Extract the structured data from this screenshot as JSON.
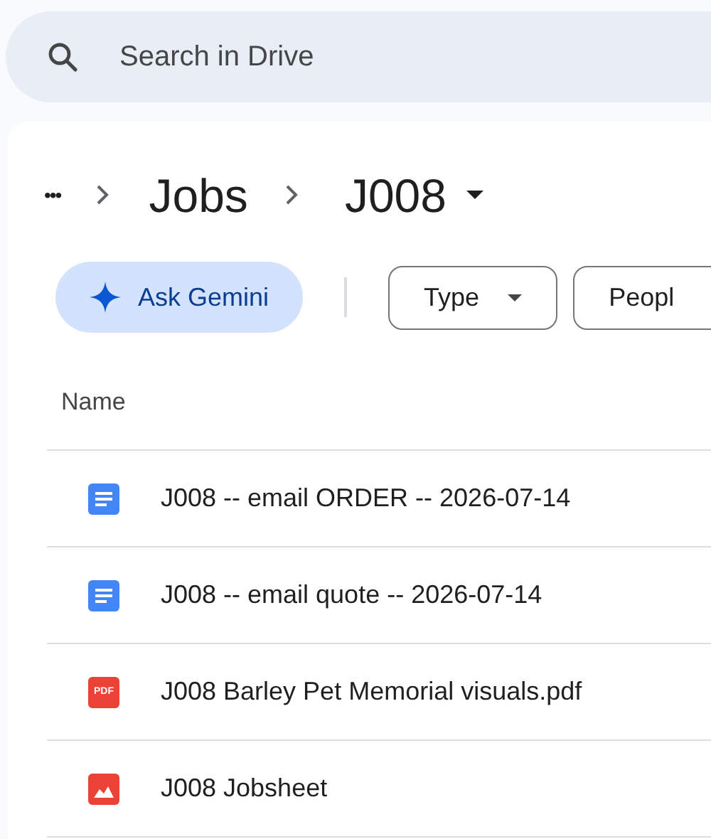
{
  "search": {
    "placeholder": "Search in Drive"
  },
  "breadcrumb": {
    "more": "•••",
    "items": [
      "Jobs",
      "J008"
    ]
  },
  "toolbar": {
    "ask": "Ask Gemini",
    "filters": [
      {
        "label": "Type",
        "dropdown": true
      },
      {
        "label": "Peopl",
        "dropdown": false
      }
    ]
  },
  "table": {
    "columns": [
      "Name"
    ],
    "rows": [
      {
        "kind": "doc",
        "name": "J008 -- email ORDER -- 2026-07-14"
      },
      {
        "kind": "doc",
        "name": "J008 -- email quote -- 2026-07-14"
      },
      {
        "kind": "pdf",
        "badge": "PDF",
        "name": "J008 Barley Pet Memorial visuals.pdf"
      },
      {
        "kind": "image",
        "name": "J008 Jobsheet"
      }
    ]
  }
}
